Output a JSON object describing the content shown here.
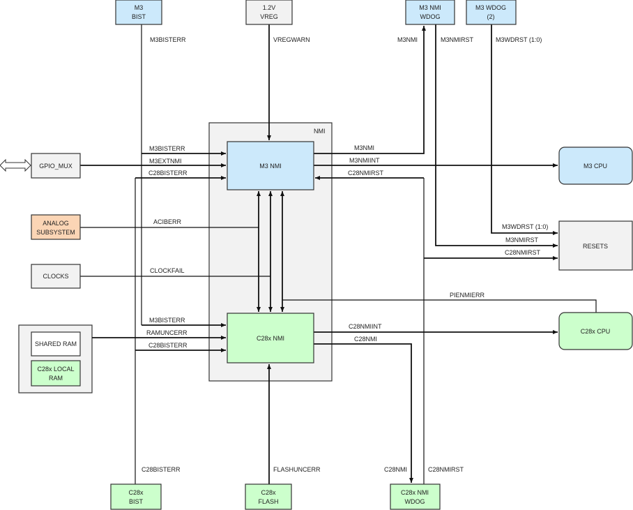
{
  "colors": {
    "blue": "#cce9fb",
    "green": "#ccffcc",
    "gray": "#f2f2f2",
    "orange": "#fbd5b5",
    "white": "#ffffff"
  },
  "blocks": {
    "m3_bist": [
      "M3",
      "BIST"
    ],
    "vreg": [
      "1.2V",
      "VREG"
    ],
    "m3_nmi_wdog": [
      "M3 NMI",
      "WDOG"
    ],
    "m3_wdog": [
      "M3 WDOG",
      "(2)"
    ],
    "nmi_group": "NMI",
    "m3_nmi": "M3 NMI",
    "c28_nmi": "C28x NMI",
    "gpio_mux": "GPIO_MUX",
    "analog": [
      "ANALOG",
      "SUBSYSTEM"
    ],
    "clocks": "CLOCKS",
    "shared_ram": "SHARED RAM",
    "c28_local_ram": [
      "C28x LOCAL",
      "RAM"
    ],
    "m3_cpu": "M3 CPU",
    "resets": "RESETS",
    "c28_cpu": "C28x CPU",
    "c28_bist": [
      "C28x",
      "BIST"
    ],
    "c28_flash": [
      "C28x",
      "FLASH"
    ],
    "c28_nmi_wdog": [
      "C28x NMI",
      "WDOG"
    ]
  },
  "signals": {
    "m3bisterr_top": "M3BISTERR",
    "vregwarn": "VREGWARN",
    "m3nmi_top": "M3NMI",
    "m3nmirst_top": "M3NMIRST",
    "m3wdrst_top": "M3WDRST (1:0)",
    "m3bisterr_m3": "M3BISTERR",
    "m3extnmi": "M3EXTNMI",
    "c28bisterr_m3": "C28BISTERR",
    "aciberr": "ACIBERR",
    "clockfail": "CLOCKFAIL",
    "m3bisterr_c28": "M3BISTERR",
    "ramuncerr": "RAMUNCERR",
    "c28bisterr_c28": "C28BISTERR",
    "m3nmi_out": "M3NMI",
    "m3nmiint": "M3NMIINT",
    "c28nmirst_in": "C28NMIRST",
    "m3wdrst_resets": "M3WDRST (1:0)",
    "m3nmirst_resets": "M3NMIRST",
    "c28nmirst_resets": "C28NMIRST",
    "pienmierr": "PIENMIERR",
    "c28nmiint": "C28NMIINT",
    "c28nmi_out": "C28NMI",
    "c28bisterr_bottom": "C28BISTERR",
    "flashuncerr": "FLASHUNCERR",
    "c28nmi_bottom": "C28NMI",
    "c28nmirst_bottom": "C28NMIRST"
  }
}
